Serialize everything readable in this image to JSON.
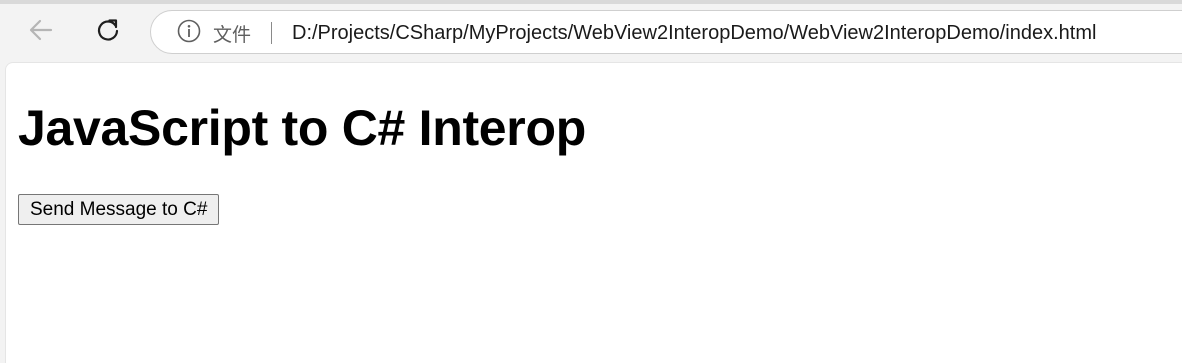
{
  "browser": {
    "site_info_label": "文件",
    "url": "D:/Projects/CSharp/MyProjects/WebView2InteropDemo/WebView2InteropDemo/index.html",
    "icons": {
      "back": "arrow-left-icon",
      "reload": "reload-icon",
      "info": "info-circle-icon"
    }
  },
  "page": {
    "heading": "JavaScript to C# Interop",
    "send_button_label": "Send Message to C#"
  },
  "colors": {
    "chrome_background": "#f3f3f3",
    "page_background": "#ffffff",
    "button_background": "#efefef",
    "button_border": "#767676"
  }
}
